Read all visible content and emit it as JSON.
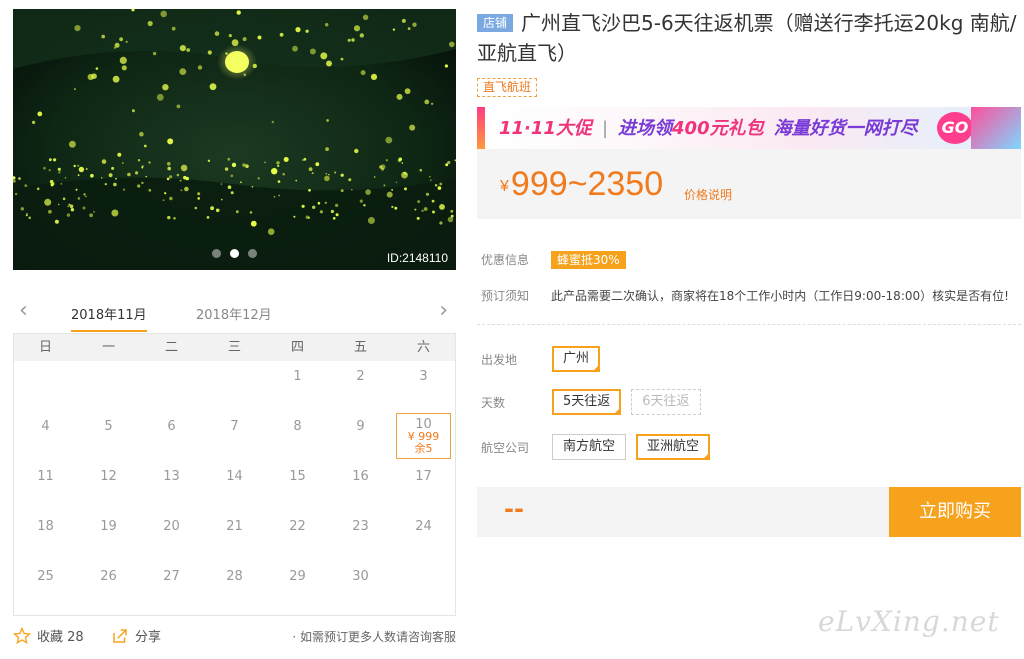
{
  "gallery": {
    "image_id": "ID:2148110",
    "active_dot": 1,
    "dot_count": 3
  },
  "calendar": {
    "prev_arrow": "‹",
    "next_arrow": "›",
    "months": [
      "2018年11月",
      "2018年12月"
    ],
    "weekdays": [
      "日",
      "一",
      "二",
      "三",
      "四",
      "五",
      "六"
    ],
    "days": [
      "",
      "",
      "",
      "",
      "1",
      "2",
      "3",
      "4",
      "5",
      "6",
      "7",
      "8",
      "9",
      "10",
      "11",
      "12",
      "13",
      "14",
      "15",
      "16",
      "17",
      "18",
      "19",
      "20",
      "21",
      "22",
      "23",
      "24",
      "25",
      "26",
      "27",
      "28",
      "29",
      "30",
      ""
    ],
    "selected_day": {
      "day": "10",
      "price": "¥ 999",
      "stock": "余5"
    }
  },
  "actions": {
    "favorite_label": "收藏 28",
    "share_label": "分享",
    "note": "· 如需预订更多人数请咨询客服"
  },
  "product": {
    "shop_tag": "店铺",
    "title": "广州直飞沙巴5-6天往返机票（赠送行李托运20kg 南航/亚航直飞）",
    "route_tag": "直飞航班"
  },
  "promo_banner": {
    "event": "11·11大促",
    "offer_prefix": "进场领",
    "offer_amount": "400元礼包",
    "slogan": "海量好货一网打尽",
    "go": "GO"
  },
  "price": {
    "currency": "¥",
    "range": "999~2350",
    "note": "价格说明"
  },
  "info": {
    "discount_label": "优惠信息",
    "discount_badge": "蜂蜜抵30%",
    "notice_label": "预订须知",
    "notice_text": "此产品需要二次确认，商家将在18个工作小时内（工作日9:00-18:00）核实是否有位!"
  },
  "options": {
    "departure_label": "出发地",
    "departure": [
      "广州"
    ],
    "days_label": "天数",
    "days": [
      "5天往返",
      "6天往返"
    ],
    "airline_label": "航空公司",
    "airlines": [
      "南方航空",
      "亚洲航空"
    ]
  },
  "buy": {
    "total": "--",
    "button": "立即购买"
  },
  "watermark": "eLvXing.net",
  "colors": {
    "accent": "#f7a21d",
    "price": "#f07a1c",
    "shop_tag": "#7aa8e0"
  }
}
